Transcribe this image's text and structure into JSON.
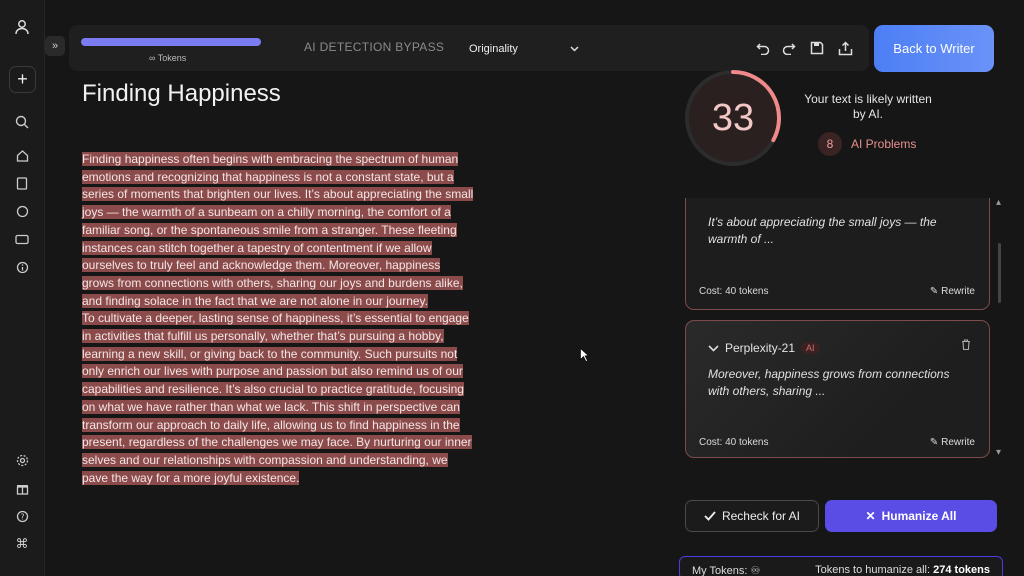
{
  "topbar": {
    "tokens_label": "∞ Tokens",
    "mode_tab": "AI DETECTION BYPASS",
    "detector_select": "Originality",
    "back_button": "Back to Writer"
  },
  "icons": {
    "user": "user-icon",
    "new": "plus-icon",
    "search": "search-icon",
    "home": "home-icon",
    "docs": "document-icon",
    "chat": "chat-icon",
    "ticket": "ticket-icon",
    "info": "info-icon",
    "settings": "gear-icon",
    "gift": "gift-icon",
    "help": "help-icon",
    "command": "command-icon",
    "undo": "undo-icon",
    "redo": "redo-icon",
    "save": "save-icon",
    "share": "share-icon"
  },
  "editor": {
    "title": "Finding Happiness",
    "paragraph1": "Finding happiness often begins with embracing the spectrum of human emotions and recognizing that happiness is not a constant state, but a series of moments that brighten our lives. It’s about appreciating the small joys — the warmth of a sunbeam on a chilly morning, the comfort of a familiar song, or the spontaneous smile from a stranger. These fleeting instances can stitch together a tapestry of contentment if we allow ourselves to truly feel and acknowledge them. Moreover, happiness grows from connections with others, sharing our joys and burdens alike, and finding solace in the fact that we are not alone in our journey.",
    "paragraph2": "To cultivate a deeper, lasting sense of happiness, it’s essential to engage in activities that fulfill us personally, whether that’s pursuing a hobby, learning a new skill, or giving back to the community. Such pursuits not only enrich our lives with purpose and passion but also remind us of our capabilities and resilience. It’s also crucial to practice gratitude, focusing on what we have rather than what we lack. This shift in perspective can transform our approach to daily life, allowing us to find happiness in the present, regardless of the challenges we may face. By nurturing our inner selves and our relationships with compassion and understanding, we pave the way for a more joyful existence."
  },
  "score": {
    "value": "33",
    "fraction": 0.33,
    "message": "Your text is likely written by AI.",
    "problem_count": "8",
    "problem_label": "AI Problems",
    "ring_color": "#f08a8a"
  },
  "cards": [
    {
      "quote": "It’s about appreciating the small joys — the warmth of ...",
      "cost": "Cost: 40 tokens",
      "rewrite": "Rewrite"
    },
    {
      "name": "Perplexity-21",
      "tag": "AI",
      "quote": "Moreover, happiness grows from connections with others, sharing ...",
      "cost": "Cost: 40 tokens",
      "rewrite": "Rewrite"
    }
  ],
  "actions": {
    "recheck": "Recheck for AI",
    "humanize": "Humanize All"
  },
  "footer": {
    "my_tokens": "My Tokens: ♾",
    "humanize_prefix": "Tokens to humanize all: ",
    "humanize_value": "274 tokens"
  }
}
